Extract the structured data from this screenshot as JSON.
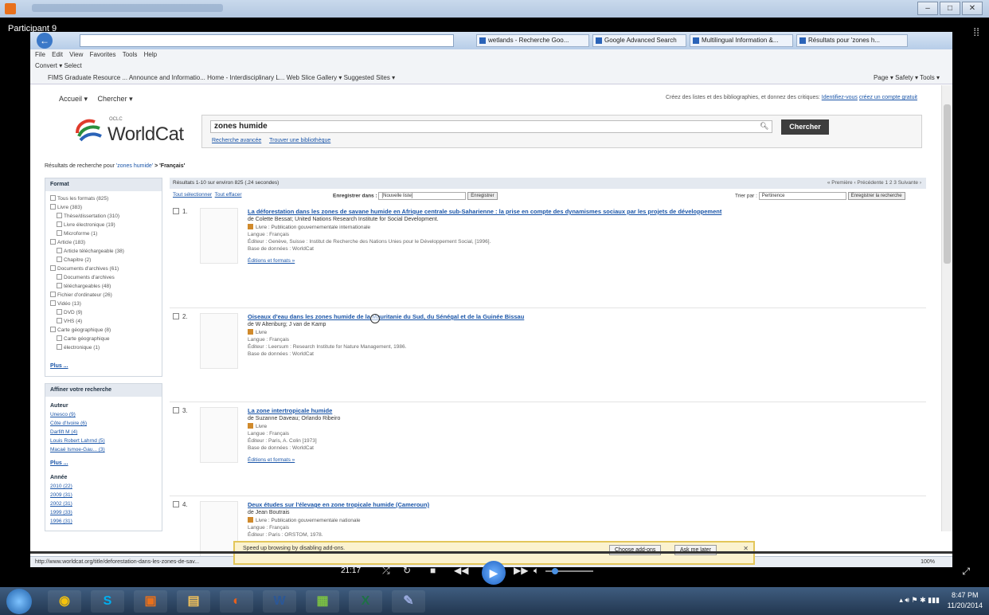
{
  "player": {
    "participant": "Participant 9",
    "time": "21:17",
    "progress_fraction": 0.0
  },
  "browser": {
    "tabs": [
      "wetlands - Recherche Goo...",
      "Google Advanced Search",
      "Multilingual Information &...",
      "Résultats pour 'zones h..."
    ],
    "menu": [
      "File",
      "Edit",
      "View",
      "Favorites",
      "Tools",
      "Help"
    ],
    "cmd": "Convert  ▾  Select",
    "favorites": "FIMS Graduate Resource ...    Announce and Informatio...    Home - Interdisciplinary L...    Web Slice Gallery ▾    Suggested Sites ▾",
    "tools": "Page ▾  Safety ▾  Tools ▾",
    "status_url": "http://www.worldcat.org/title/deforestation-dans-les-zones-de-sav...",
    "zoom": "100%"
  },
  "notification": {
    "text": "Speed up browsing by disabling add-ons.",
    "choose": "Choose add-ons",
    "later": "Ask me later"
  },
  "worldcat": {
    "nav_accueil": "Accueil  ▾",
    "nav_chercher": "Chercher  ▾",
    "top_note": "Créez des listes et des bibliographies, et donnez des critiques:",
    "top_link1": "Identifiez-vous",
    "top_link2": "créez un compte gratuit",
    "oclc": "OCLC",
    "logo": "WorldCat",
    "search_value": "zones humide",
    "search_button": "Chercher",
    "link_advanced": "Recherche avancée",
    "link_library": "Trouver une bibliothèque",
    "results_for_prefix": "Résultats de recherche pour",
    "results_for_query": "'zones humide'",
    "results_for_suffix": "> 'Français'",
    "facets": {
      "format_title": "Format",
      "items": [
        {
          "label": "Tous les formats (825)",
          "level": 1
        },
        {
          "label": "Livre (383)",
          "level": 1
        },
        {
          "label": "Thèse/dissertation (310)",
          "level": 2
        },
        {
          "label": "Livre électronique (19)",
          "level": 2
        },
        {
          "label": "Microforme (1)",
          "level": 2
        },
        {
          "label": "Article (183)",
          "level": 1
        },
        {
          "label": "Article téléchargeable (38)",
          "level": 2
        },
        {
          "label": "Chapitre (2)",
          "level": 2
        },
        {
          "label": "Documents d'archives (61)",
          "level": 1
        },
        {
          "label": "Documents d'archives",
          "level": 2
        },
        {
          "label": "téléchargeables (48)",
          "level": 2
        },
        {
          "label": "Fichier d'ordinateur (26)",
          "level": 1
        },
        {
          "label": "Vidéo (13)",
          "level": 1
        },
        {
          "label": "DVD (9)",
          "level": 2
        },
        {
          "label": "VHS (4)",
          "level": 2
        },
        {
          "label": "Carte géographique (8)",
          "level": 1
        },
        {
          "label": "Carte géographique",
          "level": 2
        },
        {
          "label": "électronique (1)",
          "level": 2
        }
      ],
      "more": "Plus ...",
      "refine_title": "Affiner votre recherche",
      "author_title": "Auteur",
      "authors": [
        "Unesco (9)",
        "Côte d'Ivoire (6)",
        "Darfift M (4)",
        "Louis Robert Lahrnd (5)",
        "Macaé Ismoe-Gau... (3)"
      ],
      "author_more": "Plus ...",
      "year_title": "Année",
      "years": [
        "2010 (22)",
        "2009 (31)",
        "2002 (31)",
        "1999 (33)",
        "1996 (31)"
      ]
    },
    "results_header": "Résultats 1-10 sur environ 825 (.24 secondes)",
    "pager": "« Première  ‹ Précédente  1  2  3  Suivante ›",
    "select_all": "Tout sélectionner",
    "clear_all": "Tout effacer",
    "save_in": "Enregistrer dans :",
    "save_select": "[Nouvelle liste]",
    "save_btn": "Enregistrer",
    "sort_label": "Trier par :",
    "sort_value": "Pertinence",
    "save_search_btn": "Enregistrer la recherche",
    "results": [
      {
        "num": "1.",
        "title": "La déforestation dans les zones de savane humide en Afrique centrale sub-Saharienne : la prise en compte des dynamismes sociaux par les projets de développement",
        "author": "de Colette Bessat; United Nations Research Institute for Social Development.",
        "format": "Livre : Publication gouvernementale internationale",
        "lang": "Langue : Français",
        "publisher": "Éditeur : Genève, Suisse : Institut de Recherche des Nations Unies pour le Développement Social, [1996].",
        "db": "Base de données : WorldCat",
        "link": "Éditions et formats »"
      },
      {
        "num": "2.",
        "title": "Oiseaux d'eau dans les zones humide de la Mauritanie du Sud, du Sénégal et de la Guinée Bissau",
        "author": "de W Altenburg; J van de Kamp",
        "format": "Livre",
        "lang": "Langue : Français",
        "publisher": "Éditeur : Leersum : Research Institute for Nature Management, 1986.",
        "db": "Base de données : WorldCat",
        "link": ""
      },
      {
        "num": "3.",
        "title": "La zone intertropicale humide",
        "author": "de Suzanne Daveau; Orlando Ribeiro",
        "format": "Livre",
        "lang": "Langue : Français",
        "publisher": "Éditeur : Paris, A. Colin [1973]",
        "db": "Base de données : WorldCat",
        "link": "Éditions et formats »"
      },
      {
        "num": "4.",
        "title": "Deux études sur l'élevage en zone tropicale humide (Cameroun)",
        "author": "de Jean Boutrais",
        "format": "Livre : Publication gouvernementale nationale",
        "lang": "Langue : Français",
        "publisher": "Éditeur : Paris : ORSTOM, 1978.",
        "db": "",
        "link": ""
      }
    ]
  },
  "taskbar": {
    "time": "8:47 PM",
    "date": "11/20/2014"
  },
  "colors": {
    "link": "#1a55a8",
    "player_bg": "#000000",
    "taskbar": "#2b4566"
  }
}
